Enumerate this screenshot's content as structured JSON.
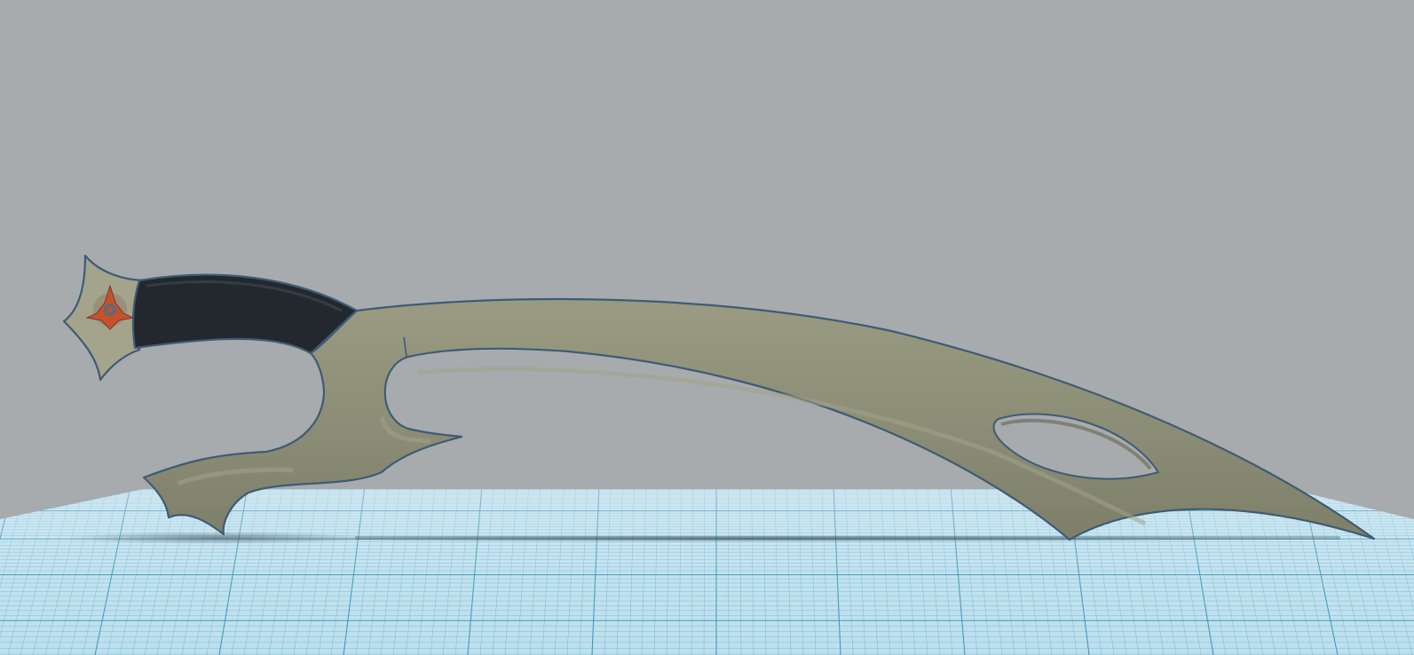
{
  "viewport": {
    "background_color": "#a7abae",
    "workplane_color": "#bde0ee",
    "grid_line_color": "#6fb3cd",
    "grid_major_line_color": "#3f93b8"
  },
  "model": {
    "type": "sword",
    "body_color": "#8a8b74",
    "body_highlight_color": "#a4a48c",
    "outline_color": "#3f5b74",
    "grip_color": "#22282e",
    "emblem_color": "#c5512d",
    "emblem_icon": "trefoil-emblem-icon"
  }
}
